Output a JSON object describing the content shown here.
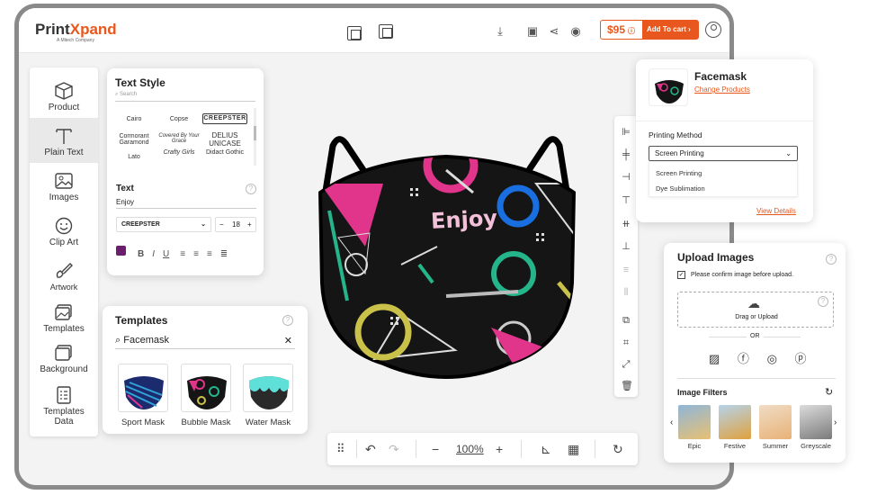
{
  "brand": {
    "name_a": "Print",
    "name_b": "Xpand",
    "tagline": "A Mitech Company"
  },
  "header": {
    "price": "$95",
    "cart_label": "Add To cart",
    "accent": "#e8571e"
  },
  "sidebar": {
    "items": [
      {
        "label": "Product",
        "icon": "cube-icon"
      },
      {
        "label": "Plain Text",
        "icon": "text-icon"
      },
      {
        "label": "Images",
        "icon": "image-icon"
      },
      {
        "label": "Clip Art",
        "icon": "smiley-icon"
      },
      {
        "label": "Artwork",
        "icon": "palette-icon"
      },
      {
        "label": "Templates",
        "icon": "templates-icon"
      },
      {
        "label": "Background",
        "icon": "background-icon"
      },
      {
        "label": "Templates",
        "label2": "Data",
        "icon": "data-icon"
      }
    ]
  },
  "text_style": {
    "title": "Text Style",
    "search_placeholder": "Search",
    "fonts": [
      [
        "Cairo",
        "Copse",
        "CREEPSTER"
      ],
      [
        "Cormorant Garamond",
        "Covered By Your Grace",
        "DELIUS UNICASE"
      ],
      [
        "Lato",
        "Crafty Girls",
        "Didact Gothic"
      ]
    ],
    "text_label": "Text",
    "text_value": "Enjoy",
    "font_select": "CREEPSTER",
    "font_size": "18",
    "text_color": "#6b1e6e"
  },
  "templates": {
    "title": "Templates",
    "search_value": "Facemask",
    "items": [
      "Sport Mask",
      "Bubble Mask",
      "Water Mask"
    ]
  },
  "canvas": {
    "mask_text": "Enjoy"
  },
  "zoom": {
    "value": "100%"
  },
  "product_panel": {
    "name": "Facemask",
    "change_link": "Change Products",
    "method_label": "Printing Method",
    "selected": "Screen Printing",
    "options": [
      "Screen Printing",
      "Dye Sublimation"
    ],
    "details_link": "View Details"
  },
  "upload_panel": {
    "title": "Upload Images",
    "confirm_text": "Please confirm image before upload.",
    "drop_text": "Drag or Upload",
    "or_text": "OR",
    "filters_title": "Image Filters",
    "filters": [
      "Epic",
      "Festive",
      "Summer",
      "Greyscale"
    ]
  }
}
